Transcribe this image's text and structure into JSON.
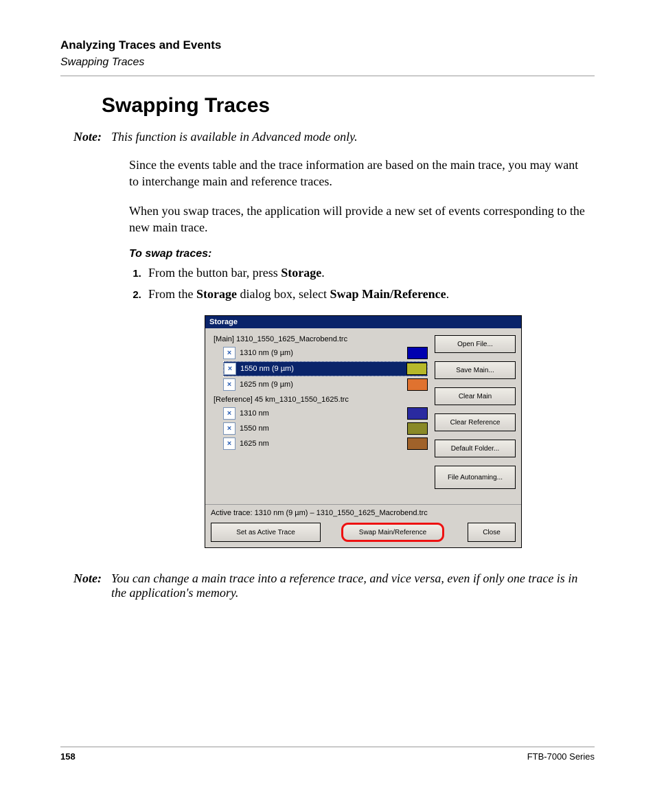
{
  "runningHead": {
    "chapter": "Analyzing Traces and Events",
    "section": "Swapping Traces"
  },
  "title": "Swapping Traces",
  "note1": {
    "label": "Note:",
    "text": "This function is available in Advanced mode only."
  },
  "para1": "Since the events table and the trace information are based on the main trace, you may want to interchange main and reference traces.",
  "para2": "When you swap traces, the application will provide a new set of events corresponding to the new main trace.",
  "procTitle": "To swap traces:",
  "step1_a": "From the button bar, press ",
  "step1_b": "Storage",
  "step1_c": ".",
  "step2_a": "From the ",
  "step2_b": "Storage",
  "step2_c": " dialog box, select ",
  "step2_d": "Swap Main/Reference",
  "step2_e": ".",
  "dialog": {
    "title": "Storage",
    "mainFile": "[Main] 1310_1550_1625_Macrobend.trc",
    "mainTraces": [
      {
        "label": "1310 nm (9 µm)",
        "color": "#0000b0"
      },
      {
        "label": "1550 nm (9 µm)",
        "color": "#b6b82a",
        "selected": true
      },
      {
        "label": "1625 nm (9 µm)",
        "color": "#e0722f"
      }
    ],
    "refFile": "[Reference] 45 km_1310_1550_1625.trc",
    "refTraces": [
      {
        "label": "1310 nm",
        "color": "#2a2aa0"
      },
      {
        "label": "1550 nm",
        "color": "#898927"
      },
      {
        "label": "1625 nm",
        "color": "#a0622a"
      }
    ],
    "sideButtons": {
      "open": "Open File...",
      "save": "Save Main...",
      "clearMain": "Clear Main",
      "clearRef": "Clear Reference",
      "defaultFolder": "Default Folder...",
      "autoname": "File Autonaming..."
    },
    "activeLine": "Active trace: 1310 nm (9 µm) – 1310_1550_1625_Macrobend.trc",
    "bottom": {
      "setActive": "Set as Active Trace",
      "swap": "Swap Main/Reference",
      "close": "Close"
    }
  },
  "note2": {
    "label": "Note:",
    "text": "You can change a main trace into a reference trace, and vice versa, even if only one trace is in the application's memory."
  },
  "footer": {
    "page": "158",
    "series": "FTB-7000 Series"
  }
}
